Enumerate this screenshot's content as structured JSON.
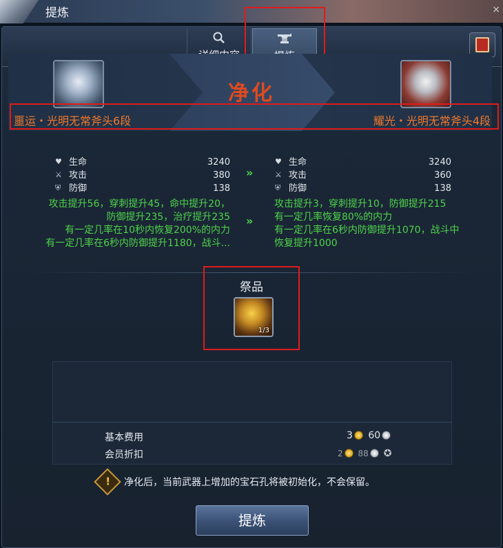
{
  "window": {
    "title": "提炼"
  },
  "tabs": [
    {
      "label": "详细内容",
      "icon": "search-icon"
    },
    {
      "label": "提炼",
      "icon": "anvil-icon"
    }
  ],
  "banner": {
    "title": "净化"
  },
  "source_item": {
    "name": "噩运・光明无常斧头6段",
    "stats": [
      {
        "name": "生命",
        "value": "3240",
        "icon": "heart-icon"
      },
      {
        "name": "攻击",
        "value": "380",
        "icon": "swords-icon"
      },
      {
        "name": "防御",
        "value": "138",
        "icon": "shield-icon"
      }
    ],
    "effects": [
      "攻击提升56，穿刺提升45，命中提升20，",
      "防御提升235，治疗提升235",
      "有一定几率在10秒内恢复200%的内力",
      "有一定几率在6秒内防御提升1180，战斗..."
    ]
  },
  "result_item": {
    "name": "耀光・光明无常斧头4段",
    "stats": [
      {
        "name": "生命",
        "value": "3240",
        "icon": "heart-icon"
      },
      {
        "name": "攻击",
        "value": "360",
        "icon": "swords-icon"
      },
      {
        "name": "防御",
        "value": "138",
        "icon": "shield-icon"
      }
    ],
    "effects": [
      "攻击提升3，穿刺提升10，防御提升215",
      "有一定几率恢复80%的内力",
      "有一定几率在6秒内防御提升1070，战斗中",
      "恢复提升1000"
    ]
  },
  "arrows": [
    "»",
    "»"
  ],
  "offering": {
    "label": "祭品",
    "count": "1/3"
  },
  "cost": {
    "base_label": "基本费用",
    "base_gold": "3",
    "base_silver": "60",
    "member_label": "会员折扣",
    "member_gold": "2",
    "member_silver": "88"
  },
  "warning": {
    "icon_glyph": "!",
    "text": "净化后，当前武器上增加的宝石孔将被初始化，不会保留。"
  },
  "action_button": {
    "label": "提炼"
  }
}
